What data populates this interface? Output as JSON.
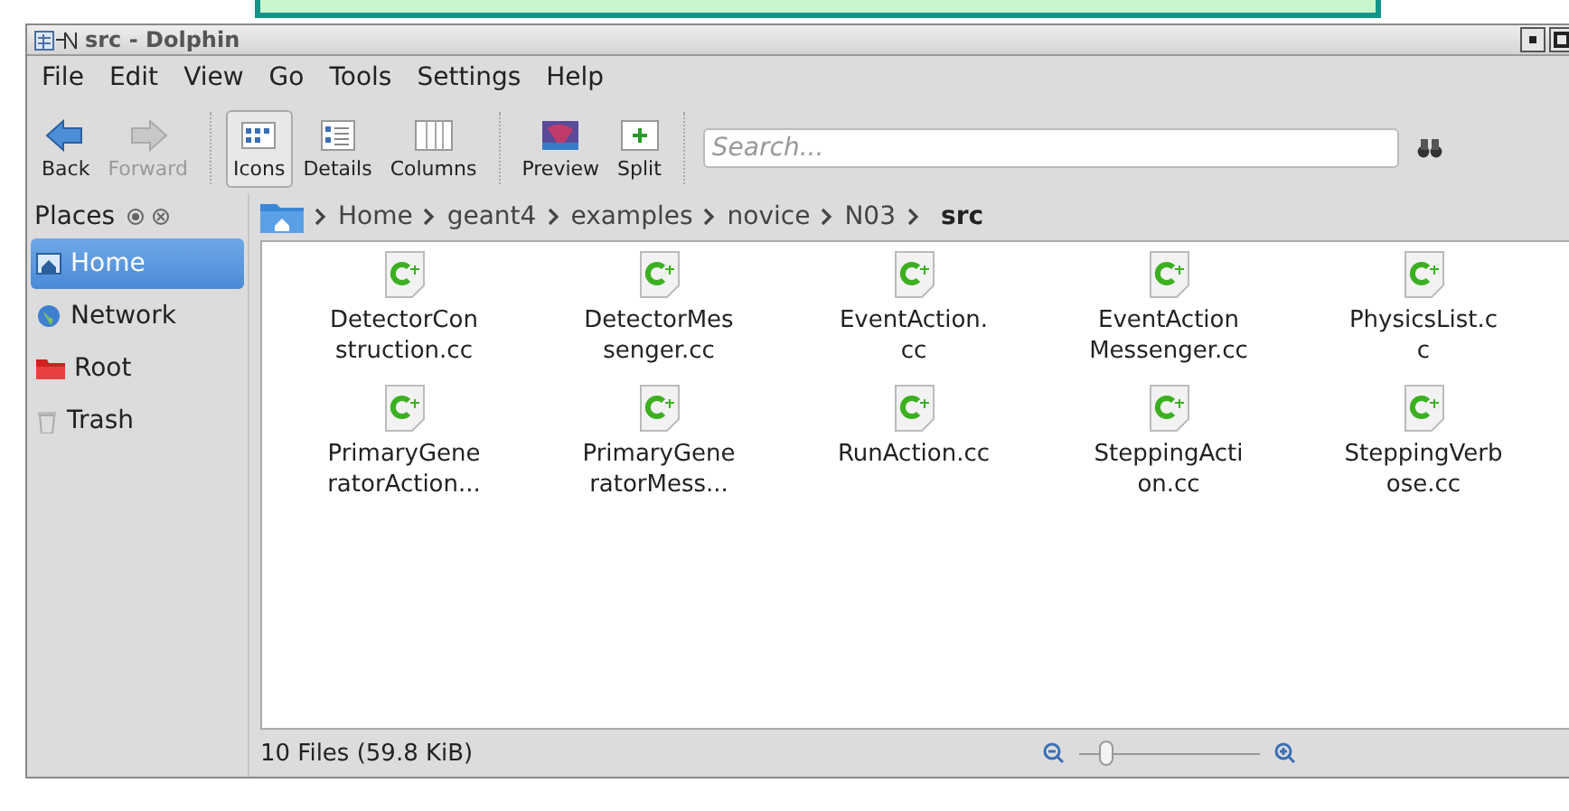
{
  "window": {
    "title": "src - Dolphin"
  },
  "menu": [
    "File",
    "Edit",
    "View",
    "Go",
    "Tools",
    "Settings",
    "Help"
  ],
  "toolbar": [
    {
      "kind": "back",
      "label": "Back",
      "disabled": false,
      "selected": false
    },
    {
      "kind": "forward",
      "label": "Forward",
      "disabled": true,
      "selected": false
    },
    {
      "kind": "icons",
      "label": "Icons",
      "disabled": false,
      "selected": true
    },
    {
      "kind": "details",
      "label": "Details",
      "disabled": false,
      "selected": false
    },
    {
      "kind": "columns",
      "label": "Columns",
      "disabled": false,
      "selected": false
    },
    {
      "kind": "preview",
      "label": "Preview",
      "disabled": false,
      "selected": false
    },
    {
      "kind": "split",
      "label": "Split",
      "disabled": false,
      "selected": false
    }
  ],
  "search": {
    "placeholder": "Search..."
  },
  "places": {
    "title": "Places",
    "items": [
      {
        "kind": "home",
        "label": "Home",
        "selected": true
      },
      {
        "kind": "network",
        "label": "Network",
        "selected": false
      },
      {
        "kind": "root",
        "label": "Root",
        "selected": false
      },
      {
        "kind": "trash",
        "label": "Trash",
        "selected": false
      }
    ]
  },
  "breadcrumb": [
    "Home",
    "geant4",
    "examples",
    "novice",
    "N03",
    "src"
  ],
  "files": [
    {
      "name": "DetectorCon\nstruction.cc"
    },
    {
      "name": "DetectorMes\nsenger.cc"
    },
    {
      "name": "EventAction.\ncc"
    },
    {
      "name": "EventAction\nMessenger.cc"
    },
    {
      "name": "PhysicsList.c\nc"
    },
    {
      "name": "PrimaryGene\nratorAction..."
    },
    {
      "name": "PrimaryGene\nratorMess..."
    },
    {
      "name": "RunAction.cc"
    },
    {
      "name": "SteppingActi\non.cc"
    },
    {
      "name": "SteppingVerb\nose.cc"
    }
  ],
  "status_bar": {
    "text": "10 Files (59.8 KiB)",
    "zoom": {
      "level": 0.15
    }
  }
}
